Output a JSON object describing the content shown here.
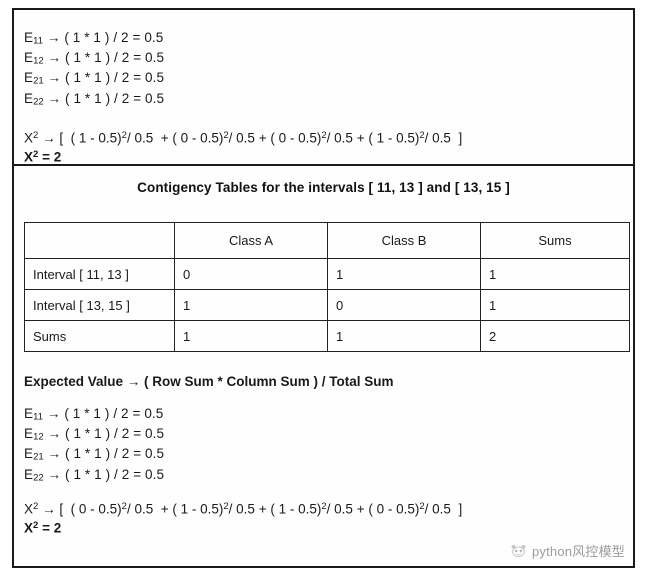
{
  "document": {
    "top_section": {
      "expected_values": [
        {
          "label": "E",
          "sub": "11",
          "arrow": "→",
          "expr": "( 1 * 1 ) / 2 = 0.5"
        },
        {
          "label": "E",
          "sub": "12",
          "arrow": "→",
          "expr": "( 1 * 1 ) / 2 = 0.5"
        },
        {
          "label": "E",
          "sub": "21",
          "arrow": "→",
          "expr": "( 1 * 1 ) / 2 = 0.5"
        },
        {
          "label": "E",
          "sub": "22",
          "arrow": "→",
          "expr": "( 1 * 1 ) / 2 = 0.5"
        }
      ],
      "chi_formula": {
        "symbol": "X",
        "exponent": "2",
        "arrow": "→",
        "open_bracket": "[",
        "terms": [
          {
            "numerator": "( 1 - 0.5)",
            "power": "2",
            "denominator": "/ 0.5"
          },
          {
            "numerator": "( 0 - 0.5)",
            "power": "2",
            "denominator": "/ 0.5"
          },
          {
            "numerator": "( 0 - 0.5)",
            "power": "2",
            "denominator": "/ 0.5"
          },
          {
            "numerator": "( 1 - 0.5)",
            "power": "2",
            "denominator": "/ 0.5"
          }
        ],
        "close_bracket": "]"
      },
      "chi_result": {
        "symbol": "X",
        "exponent": "2",
        "equals": "= 2"
      }
    },
    "bottom_section": {
      "title": "Contigency Tables for the intervals [ 11, 13  ] and [ 13, 15 ]",
      "table": {
        "headers": [
          "",
          "Class A",
          "Class B",
          "Sums"
        ],
        "rows": [
          [
            "Interval [ 11, 13 ]",
            "0",
            "1",
            "1"
          ],
          [
            "Interval [ 13, 15 ]",
            "1",
            "0",
            "1"
          ],
          [
            "Sums",
            "1",
            "1",
            "2"
          ]
        ]
      },
      "expected_value_rule": "Expected Value → ( Row Sum * Column Sum ) / Total Sum",
      "expected_values": [
        {
          "label": "E",
          "sub": "11",
          "arrow": "→",
          "expr": "( 1 * 1 ) / 2 = 0.5"
        },
        {
          "label": "E",
          "sub": "12",
          "arrow": "→",
          "expr": "( 1 * 1 ) / 2 = 0.5"
        },
        {
          "label": "E",
          "sub": "21",
          "arrow": "→",
          "expr": "( 1 * 1 ) / 2 = 0.5"
        },
        {
          "label": "E",
          "sub": "22",
          "arrow": "→",
          "expr": "( 1 * 1 ) / 2 = 0.5"
        }
      ],
      "chi_formula": {
        "symbol": "X",
        "exponent": "2",
        "arrow": "→",
        "open_bracket": "[",
        "terms": [
          {
            "numerator": "( 0 - 0.5)",
            "power": "2",
            "denominator": "/ 0.5"
          },
          {
            "numerator": "( 1 - 0.5)",
            "power": "2",
            "denominator": "/ 0.5"
          },
          {
            "numerator": "( 1 - 0.5)",
            "power": "2",
            "denominator": "/ 0.5"
          },
          {
            "numerator": "( 0 - 0.5)",
            "power": "2",
            "denominator": "/ 0.5"
          }
        ],
        "close_bracket": "]"
      },
      "chi_result": {
        "symbol": "X",
        "exponent": "2",
        "equals": "= 2"
      }
    },
    "watermark": {
      "icon": "panda-face-icon",
      "text": "python风控模型"
    }
  }
}
